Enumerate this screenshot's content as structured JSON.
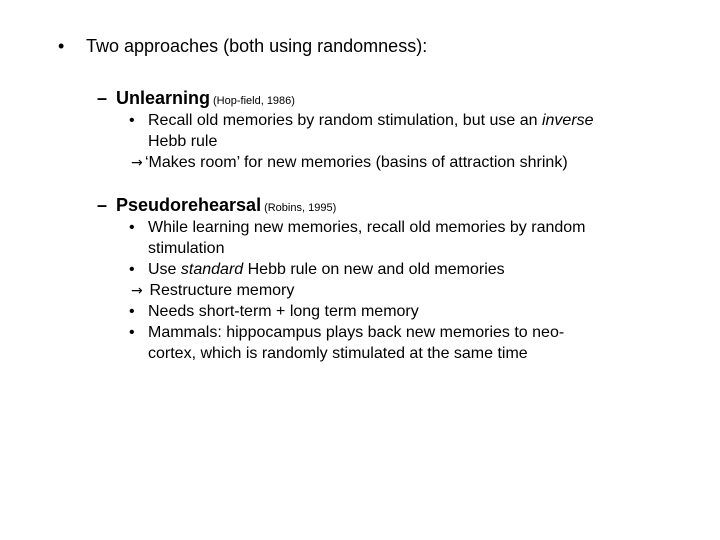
{
  "slide": {
    "top_bullet": {
      "marker": "•",
      "text": "Two approaches (both using randomness):"
    },
    "unlearning": {
      "marker": "–",
      "title": "Unlearning",
      "ref": "(Hop-field, 1986)",
      "items": [
        {
          "marker": "•",
          "line1_before": "Recall old memories by random stimulation, but use an ",
          "line1_em": "inverse",
          "line2": "Hebb rule"
        }
      ],
      "arrow_item": {
        "marker": "→",
        "text": "‘Makes room’ for new memories (basins of attraction shrink)"
      }
    },
    "pseudorehearsal": {
      "marker": "–",
      "title": "Pseudorehearsal",
      "ref": "(Robins, 1995)",
      "item1": {
        "marker": "•",
        "line1": "While learning new memories, recall old memories by random",
        "line2": "stimulation"
      },
      "item2": {
        "marker": "•",
        "before": "Use ",
        "em": "standard",
        "after": " Hebb rule on new and old memories"
      },
      "arrow_item": {
        "marker": "→",
        "text": " Restructure memory"
      },
      "item3": {
        "marker": "•",
        "text": "Needs short-term + long term memory"
      },
      "item4": {
        "marker": "•",
        "line1": "Mammals: hippocampus plays back new memories to neo-",
        "line2": "cortex, which is randomly stimulated at the same time"
      }
    }
  }
}
